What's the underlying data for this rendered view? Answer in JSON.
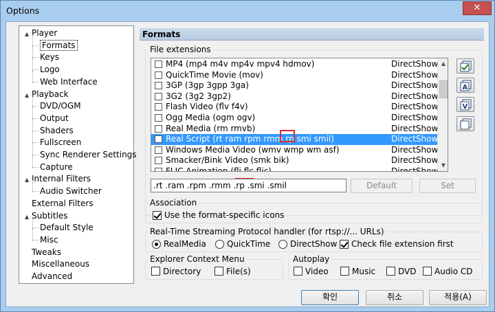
{
  "window": {
    "title": "Options",
    "close_glyph": "✕"
  },
  "tree": [
    {
      "label": "Player",
      "level": 0,
      "expander": "▲"
    },
    {
      "label": "Formats",
      "level": 1,
      "selected": true
    },
    {
      "label": "Keys",
      "level": 1
    },
    {
      "label": "Logo",
      "level": 1
    },
    {
      "label": "Web Interface",
      "level": 1
    },
    {
      "label": "Playback",
      "level": 0,
      "expander": "▲"
    },
    {
      "label": "DVD/OGM",
      "level": 1
    },
    {
      "label": "Output",
      "level": 1
    },
    {
      "label": "Shaders",
      "level": 1
    },
    {
      "label": "Fullscreen",
      "level": 1
    },
    {
      "label": "Sync Renderer Settings",
      "level": 1
    },
    {
      "label": "Capture",
      "level": 1
    },
    {
      "label": "Internal Filters",
      "level": 0,
      "expander": "▲"
    },
    {
      "label": "Audio Switcher",
      "level": 1
    },
    {
      "label": "External Filters",
      "level": 0
    },
    {
      "label": "Subtitles",
      "level": 0,
      "expander": "▲"
    },
    {
      "label": "Default Style",
      "level": 1
    },
    {
      "label": "Misc",
      "level": 1
    },
    {
      "label": "Tweaks",
      "level": 0
    },
    {
      "label": "Miscellaneous",
      "level": 0
    },
    {
      "label": "Advanced",
      "level": 0
    }
  ],
  "panel": {
    "title": "Formats"
  },
  "file_ext": {
    "group_title": "File extensions",
    "rows": [
      {
        "name": "MP4 (mp4 m4v mp4v mpv4 hdmov)",
        "format": "DirectShow"
      },
      {
        "name": "QuickTime Movie (mov)",
        "format": "DirectShow"
      },
      {
        "name": "3GP (3gp 3gpp 3ga)",
        "format": "DirectShow"
      },
      {
        "name": "3G2 (3g2 3gp2)",
        "format": "DirectShow"
      },
      {
        "name": "Flash Video (flv f4v)",
        "format": "DirectShow"
      },
      {
        "name": "Ogg Media (ogm ogv)",
        "format": "DirectShow"
      },
      {
        "name": "Real Media (rm rmvb)",
        "format": "DirectShow"
      },
      {
        "name": "Real Script (rt ram rpm rmm rp smi smil)",
        "format": "DirectShow",
        "selected": true
      },
      {
        "name": "Windows Media Video (wmv wmp wm asf)",
        "format": "DirectShow"
      },
      {
        "name": "Smacker/Bink Video (smk bik)",
        "format": "DirectShow"
      },
      {
        "name": "FLIC Animation (fli flc flic)",
        "format": "DirectShow"
      }
    ],
    "ext_value": ".rt .ram .rpm .rmm .rp .smi .smil",
    "default_label": "Default",
    "set_label": "Set"
  },
  "association": {
    "group_title": "Association",
    "checkbox_label": "Use the format-specific icons",
    "checked": true
  },
  "rtsp": {
    "group_title": "Real-Time Streaming Protocol handler (for rtsp://... URLs)",
    "options": [
      "RealMedia",
      "QuickTime",
      "DirectShow"
    ],
    "selected": "RealMedia",
    "check_ext_label": "Check file extension first",
    "check_ext_checked": true
  },
  "explorer": {
    "group_title": "Explorer Context Menu",
    "directory_label": "Directory",
    "files_label": "File(s)"
  },
  "autoplay": {
    "group_title": "Autoplay",
    "video_label": "Video",
    "music_label": "Music",
    "dvd_label": "DVD",
    "audiocd_label": "Audio CD"
  },
  "footer": {
    "ok_label": "확인",
    "cancel_label": "취소",
    "apply_label": "적용(A)"
  },
  "colors": {
    "selection": "#3399ff",
    "highlight_box": "#e0262c",
    "header_bg": "#c1d4e8"
  }
}
